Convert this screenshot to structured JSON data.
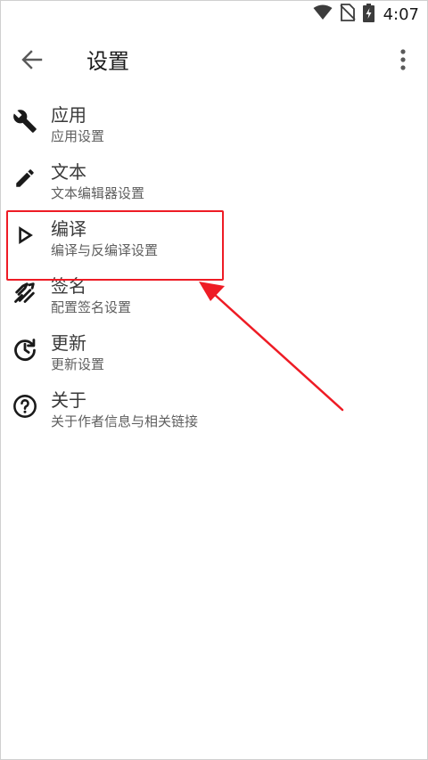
{
  "status_bar": {
    "time": "4:07",
    "icons": [
      "wifi-icon",
      "no-sim-icon",
      "battery-charging-icon"
    ]
  },
  "app_bar": {
    "title": "设置",
    "back_icon": "arrow-back-icon",
    "menu_icon": "more-vert-icon"
  },
  "settings": [
    {
      "key": "app",
      "icon": "wrench-icon",
      "title": "应用",
      "subtitle": "应用设置"
    },
    {
      "key": "text",
      "icon": "pencil-icon",
      "title": "文本",
      "subtitle": "文本编辑器设置"
    },
    {
      "key": "compile",
      "icon": "play-outline-icon",
      "title": "编译",
      "subtitle": "编译与反编译设置"
    },
    {
      "key": "signature",
      "icon": "signature-icon",
      "title": "签名",
      "subtitle": "配置签名设置"
    },
    {
      "key": "update",
      "icon": "update-icon",
      "title": "更新",
      "subtitle": "更新设置"
    },
    {
      "key": "about",
      "icon": "help-circle-icon",
      "title": "关于",
      "subtitle": "关于作者信息与相关链接"
    }
  ],
  "annotation": {
    "color": "#ee1c25",
    "highlighted_item": "compile"
  }
}
